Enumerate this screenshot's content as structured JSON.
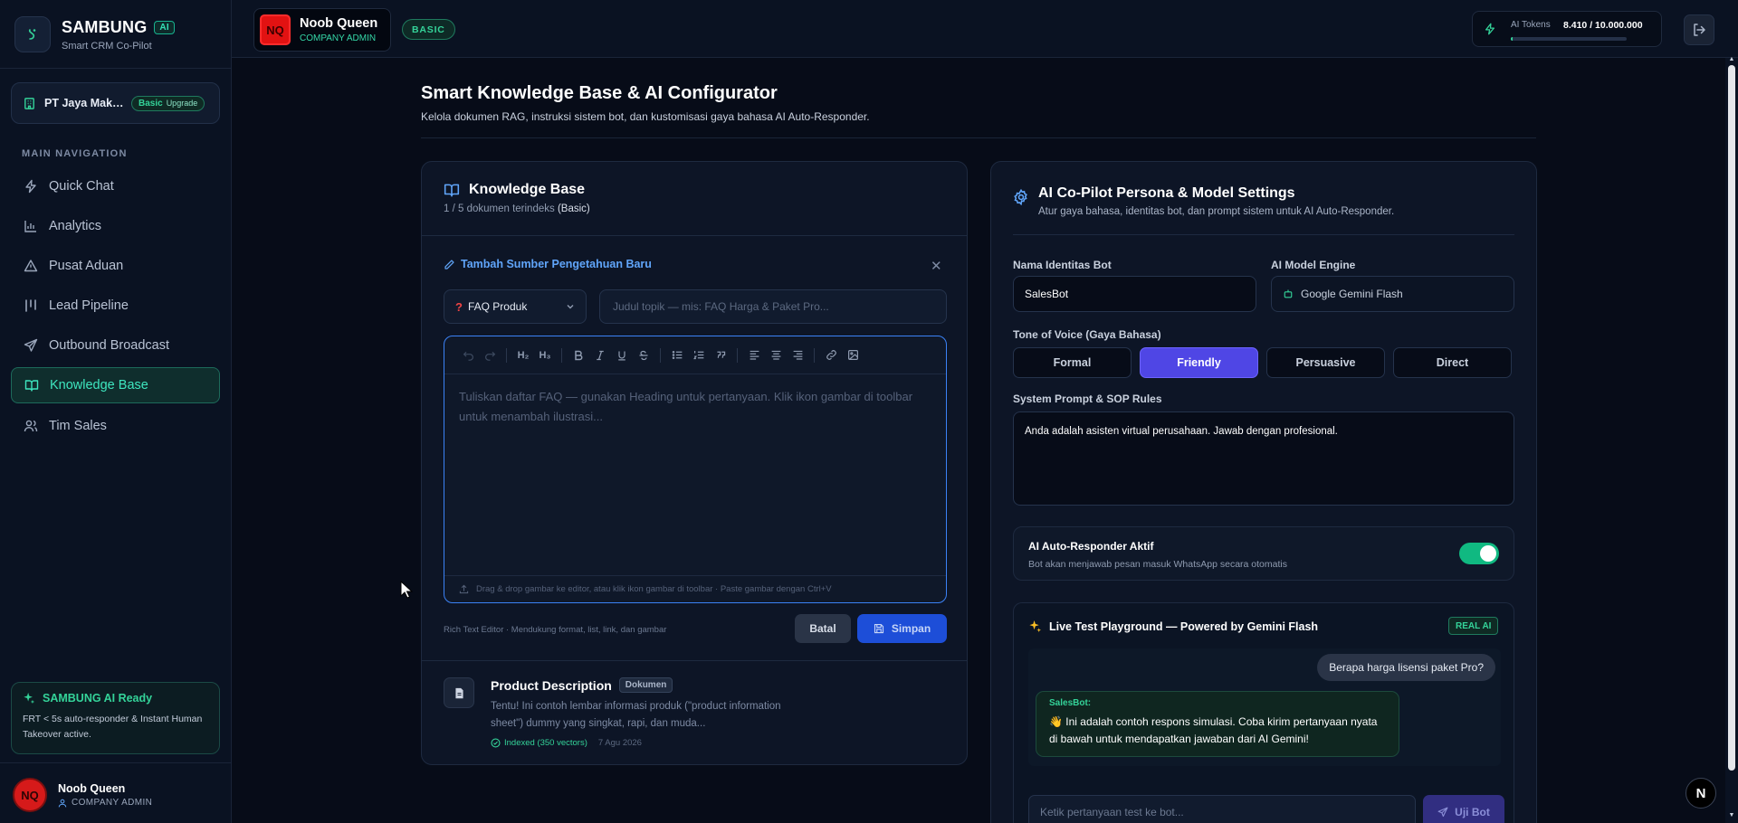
{
  "brand": {
    "name": "SAMBUNG",
    "badge": "AI",
    "tagline": "Smart CRM Co-Pilot"
  },
  "org": {
    "name": "PT Jaya Makmur",
    "plan": "Basic",
    "upgrade": "Upgrade"
  },
  "nav": {
    "title": "MAIN NAVIGATION",
    "items": [
      {
        "label": "Quick Chat",
        "icon": "zap-icon"
      },
      {
        "label": "Analytics",
        "icon": "bar-chart-icon"
      },
      {
        "label": "Pusat Aduan",
        "icon": "alert-triangle-icon"
      },
      {
        "label": "Lead Pipeline",
        "icon": "kanban-icon"
      },
      {
        "label": "Outbound Broadcast",
        "icon": "send-icon"
      },
      {
        "label": "Knowledge Base",
        "icon": "book-open-icon",
        "active": true
      },
      {
        "label": "Tim Sales",
        "icon": "users-icon"
      }
    ]
  },
  "ready": {
    "title": "SAMBUNG AI Ready",
    "text": "FRT < 5s auto-responder & Instant Human Takeover active."
  },
  "user": {
    "initials": "NQ",
    "name": "Noob Queen",
    "role": "COMPANY ADMIN"
  },
  "topbar": {
    "company_initials": "NQ",
    "company_name": "Noob Queen",
    "company_role": "COMPANY ADMIN",
    "plan": "BASIC",
    "tokens_label": "AI Tokens",
    "tokens_value": "8.410 / 10.000.000",
    "tokens_used_fraction": 0.00084
  },
  "page": {
    "title": "Smart Knowledge Base & AI Configurator",
    "subtitle": "Kelola dokumen RAG, instruksi sistem bot, dan kustomisasi gaya bahasa AI Auto-Responder."
  },
  "kb": {
    "title": "Knowledge Base",
    "count": "1 / 5 dokumen terindeks",
    "plan": "(Basic)",
    "add_title": "Tambah Sumber Pengetahuan Baru",
    "category": "FAQ Produk",
    "topic_placeholder": "Judul topik — mis: FAQ Harga & Paket Pro...",
    "editor_placeholder": "Tuliskan daftar FAQ — gunakan Heading untuk pertanyaan. Klik ikon gambar di toolbar untuk menambah ilustrasi...",
    "editor_footer": "Drag & drop gambar ke editor, atau klik ikon gambar di toolbar · Paste gambar dengan Ctrl+V",
    "editor_note": "Rich Text Editor · Mendukung format, list, link, dan gambar",
    "cancel": "Batal",
    "save": "Simpan",
    "toolbar": {
      "h2": "H₂",
      "h3": "H₃"
    },
    "document": {
      "title": "Product Description",
      "tag": "Dokumen",
      "desc": "Tentu! Ini contoh lembar informasi produk (\"product information sheet\") dummy yang singkat, rapi, dan muda...",
      "indexed": "Indexed (350 vectors)",
      "date": "7 Agu 2026"
    }
  },
  "ai": {
    "title": "AI Co-Pilot Persona & Model Settings",
    "subtitle": "Atur gaya bahasa, identitas bot, dan prompt sistem untuk AI Auto-Responder.",
    "bot_name_label": "Nama Identitas Bot",
    "bot_name": "SalesBot",
    "engine_label": "AI Model Engine",
    "engine": "Google Gemini Flash",
    "tone_label": "Tone of Voice (Gaya Bahasa)",
    "tones": [
      "Formal",
      "Friendly",
      "Persuasive",
      "Direct"
    ],
    "active_tone": "Friendly",
    "prompt_label": "System Prompt & SOP Rules",
    "prompt": "Anda adalah asisten virtual perusahaan. Jawab dengan profesional.",
    "auto_title": "AI Auto-Responder Aktif",
    "auto_sub": "Bot akan menjawab pesan masuk WhatsApp secara otomatis",
    "auto_on": true,
    "play_title": "Live Test Playground — Powered by Gemini Flash",
    "play_badge": "REAL AI",
    "user_msg": "Berapa harga lisensi paket Pro?",
    "bot_name_tag": "SalesBot:",
    "bot_msg": "👋 Ini adalah contoh respons simulasi. Coba kirim pertanyaan nyata di bawah untuk mendapatkan jawaban dari AI Gemini!",
    "test_placeholder": "Ketik pertanyaan test ke bot...",
    "test_button": "Uji Bot"
  },
  "next_badge": "N",
  "colors": {
    "accent": "#34d399",
    "primary": "#4f46e5",
    "link": "#60a5fa",
    "avatar": "#d61a1a"
  }
}
